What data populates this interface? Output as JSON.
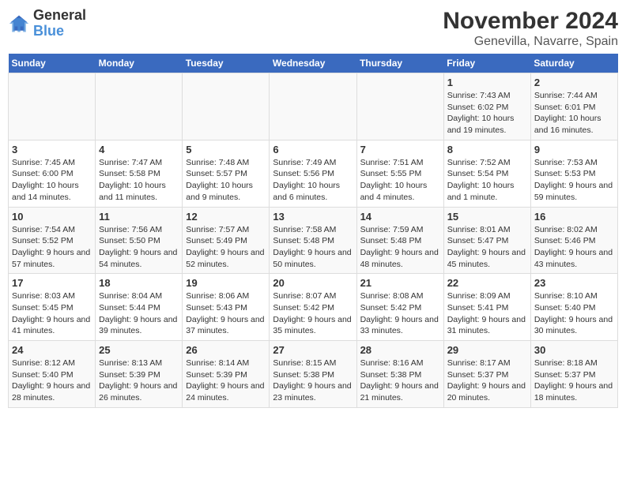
{
  "logo": {
    "line1": "General",
    "line2": "Blue"
  },
  "title": "November 2024",
  "subtitle": "Genevilla, Navarre, Spain",
  "weekdays": [
    "Sunday",
    "Monday",
    "Tuesday",
    "Wednesday",
    "Thursday",
    "Friday",
    "Saturday"
  ],
  "weeks": [
    [
      {
        "day": "",
        "info": ""
      },
      {
        "day": "",
        "info": ""
      },
      {
        "day": "",
        "info": ""
      },
      {
        "day": "",
        "info": ""
      },
      {
        "day": "",
        "info": ""
      },
      {
        "day": "1",
        "info": "Sunrise: 7:43 AM\nSunset: 6:02 PM\nDaylight: 10 hours and 19 minutes."
      },
      {
        "day": "2",
        "info": "Sunrise: 7:44 AM\nSunset: 6:01 PM\nDaylight: 10 hours and 16 minutes."
      }
    ],
    [
      {
        "day": "3",
        "info": "Sunrise: 7:45 AM\nSunset: 6:00 PM\nDaylight: 10 hours and 14 minutes."
      },
      {
        "day": "4",
        "info": "Sunrise: 7:47 AM\nSunset: 5:58 PM\nDaylight: 10 hours and 11 minutes."
      },
      {
        "day": "5",
        "info": "Sunrise: 7:48 AM\nSunset: 5:57 PM\nDaylight: 10 hours and 9 minutes."
      },
      {
        "day": "6",
        "info": "Sunrise: 7:49 AM\nSunset: 5:56 PM\nDaylight: 10 hours and 6 minutes."
      },
      {
        "day": "7",
        "info": "Sunrise: 7:51 AM\nSunset: 5:55 PM\nDaylight: 10 hours and 4 minutes."
      },
      {
        "day": "8",
        "info": "Sunrise: 7:52 AM\nSunset: 5:54 PM\nDaylight: 10 hours and 1 minute."
      },
      {
        "day": "9",
        "info": "Sunrise: 7:53 AM\nSunset: 5:53 PM\nDaylight: 9 hours and 59 minutes."
      }
    ],
    [
      {
        "day": "10",
        "info": "Sunrise: 7:54 AM\nSunset: 5:52 PM\nDaylight: 9 hours and 57 minutes."
      },
      {
        "day": "11",
        "info": "Sunrise: 7:56 AM\nSunset: 5:50 PM\nDaylight: 9 hours and 54 minutes."
      },
      {
        "day": "12",
        "info": "Sunrise: 7:57 AM\nSunset: 5:49 PM\nDaylight: 9 hours and 52 minutes."
      },
      {
        "day": "13",
        "info": "Sunrise: 7:58 AM\nSunset: 5:48 PM\nDaylight: 9 hours and 50 minutes."
      },
      {
        "day": "14",
        "info": "Sunrise: 7:59 AM\nSunset: 5:48 PM\nDaylight: 9 hours and 48 minutes."
      },
      {
        "day": "15",
        "info": "Sunrise: 8:01 AM\nSunset: 5:47 PM\nDaylight: 9 hours and 45 minutes."
      },
      {
        "day": "16",
        "info": "Sunrise: 8:02 AM\nSunset: 5:46 PM\nDaylight: 9 hours and 43 minutes."
      }
    ],
    [
      {
        "day": "17",
        "info": "Sunrise: 8:03 AM\nSunset: 5:45 PM\nDaylight: 9 hours and 41 minutes."
      },
      {
        "day": "18",
        "info": "Sunrise: 8:04 AM\nSunset: 5:44 PM\nDaylight: 9 hours and 39 minutes."
      },
      {
        "day": "19",
        "info": "Sunrise: 8:06 AM\nSunset: 5:43 PM\nDaylight: 9 hours and 37 minutes."
      },
      {
        "day": "20",
        "info": "Sunrise: 8:07 AM\nSunset: 5:42 PM\nDaylight: 9 hours and 35 minutes."
      },
      {
        "day": "21",
        "info": "Sunrise: 8:08 AM\nSunset: 5:42 PM\nDaylight: 9 hours and 33 minutes."
      },
      {
        "day": "22",
        "info": "Sunrise: 8:09 AM\nSunset: 5:41 PM\nDaylight: 9 hours and 31 minutes."
      },
      {
        "day": "23",
        "info": "Sunrise: 8:10 AM\nSunset: 5:40 PM\nDaylight: 9 hours and 30 minutes."
      }
    ],
    [
      {
        "day": "24",
        "info": "Sunrise: 8:12 AM\nSunset: 5:40 PM\nDaylight: 9 hours and 28 minutes."
      },
      {
        "day": "25",
        "info": "Sunrise: 8:13 AM\nSunset: 5:39 PM\nDaylight: 9 hours and 26 minutes."
      },
      {
        "day": "26",
        "info": "Sunrise: 8:14 AM\nSunset: 5:39 PM\nDaylight: 9 hours and 24 minutes."
      },
      {
        "day": "27",
        "info": "Sunrise: 8:15 AM\nSunset: 5:38 PM\nDaylight: 9 hours and 23 minutes."
      },
      {
        "day": "28",
        "info": "Sunrise: 8:16 AM\nSunset: 5:38 PM\nDaylight: 9 hours and 21 minutes."
      },
      {
        "day": "29",
        "info": "Sunrise: 8:17 AM\nSunset: 5:37 PM\nDaylight: 9 hours and 20 minutes."
      },
      {
        "day": "30",
        "info": "Sunrise: 8:18 AM\nSunset: 5:37 PM\nDaylight: 9 hours and 18 minutes."
      }
    ]
  ]
}
